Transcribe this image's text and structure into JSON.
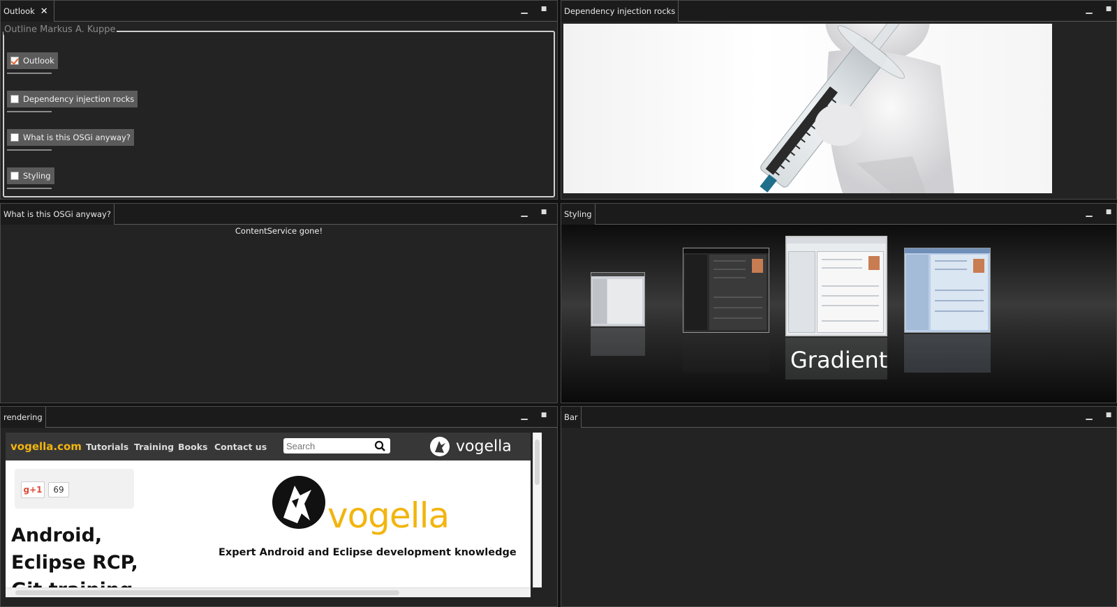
{
  "window_controls": {
    "minimize": "▁",
    "maximize": "■"
  },
  "panels": {
    "outlook": {
      "tab_label": "Outlook",
      "close_glyph": "✕",
      "legend": "Outline Markus A. Kuppe",
      "items": [
        {
          "label": "Outlook",
          "checked": true
        },
        {
          "label": "Dependency injection rocks",
          "checked": false
        },
        {
          "label": "What is this OSGi anyway?",
          "checked": false
        },
        {
          "label": "Styling",
          "checked": false
        }
      ]
    },
    "dependency_injection": {
      "tab_label": "Dependency injection rocks"
    },
    "osgi": {
      "tab_label": "What is this OSGi anyway?",
      "message": "ContentService gone!"
    },
    "styling": {
      "tab_label": "Styling",
      "caption": "Gradient"
    },
    "rendering": {
      "tab_label": "rendering",
      "site": {
        "brand": "vogella.com",
        "nav": [
          "Tutorials",
          "Training",
          "Books",
          "Contact us"
        ],
        "search_placeholder": "Search",
        "logo_text": "vogella",
        "gplus_label": "g+1",
        "gplus_count": "69",
        "headline_lines": [
          "Android,",
          "Eclipse RCP,",
          "Git training"
        ],
        "big_logo_text": "vogella",
        "tagline": "Expert Android and Eclipse development knowledge"
      }
    },
    "bar": {
      "tab_label": "Bar"
    }
  },
  "colors": {
    "panel_bg": "#232323",
    "accent_orange": "#e8632a",
    "vogella_yellow": "#f2b50f"
  }
}
